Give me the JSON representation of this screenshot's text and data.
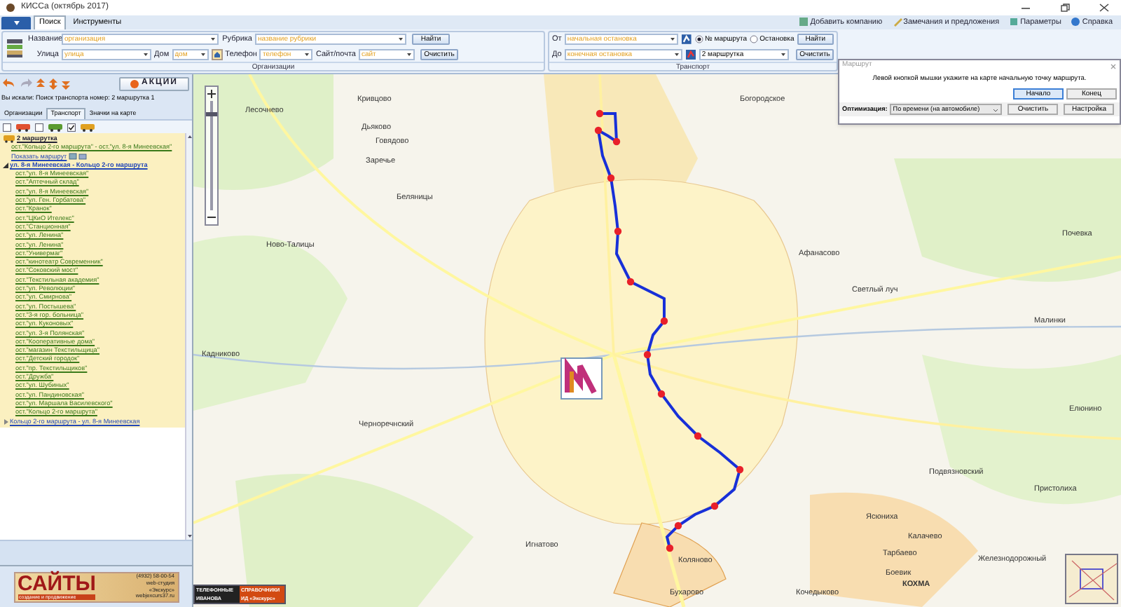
{
  "window": {
    "title": "КИССа (октябрь 2017)"
  },
  "ribbon": {
    "tabs": [
      {
        "label": "Поиск",
        "selected": true
      },
      {
        "label": "Инструменты",
        "selected": false
      }
    ],
    "links": [
      "Добавить компанию",
      "Замечания и предложения",
      "Параметры",
      "Справка"
    ],
    "organizations": {
      "label": "Организации",
      "fields": [
        {
          "label": "Название",
          "placeholder": "организация"
        },
        {
          "label": "Рубрика",
          "placeholder": "название рубрики"
        },
        {
          "label": "Улица",
          "placeholder": "улица"
        },
        {
          "label": "Дом",
          "placeholder": "дом"
        },
        {
          "label": "Телефон",
          "placeholder": "телефон"
        },
        {
          "label": "Сайт/почта",
          "placeholder": "сайт"
        }
      ],
      "buttons": [
        "Найти",
        "Очистить"
      ]
    },
    "transport": {
      "label": "Транспорт",
      "from": {
        "label": "От",
        "placeholder": "начальная остановка"
      },
      "to": {
        "label": "До",
        "placeholder": "конечная остановка"
      },
      "radios": [
        {
          "label": "№ маршрута",
          "selected": true
        },
        {
          "label": "Остановка",
          "selected": false
        }
      ],
      "route_value": "2 маршрутка",
      "buttons": [
        "Найти",
        "Очистить"
      ]
    }
  },
  "left_panel": {
    "promo_button": "АКЦИИ",
    "search_info": "Вы искали: Поиск транспорта номер: 2 маршрутка 1",
    "tabs": [
      {
        "label": "Организации",
        "selected": false
      },
      {
        "label": "Транспорт",
        "selected": true
      },
      {
        "label": "Значки на карте",
        "selected": false
      }
    ],
    "filters": [
      {
        "checked": false
      },
      {
        "checked": false
      },
      {
        "checked": true
      }
    ],
    "tree": {
      "title": "2 маршрутка",
      "summary": "ост.\"Кольцо 2-го маршрута\" - ост.\"ул. 8-я Минеевская\"",
      "show_link": "Показать маршрут",
      "directions": [
        {
          "label": "ул. 8-я Минеевская - Кольцо 2-го маршрута",
          "expanded": true,
          "children": [
            "ост.\"ул. 8-я Минеевская\"",
            "ост.\"Аптечный склад\"",
            "ост.\"ул. 8-я Минеевская\"",
            "ост.\"ул. Ген. Горбатова\"",
            "ост.\"Кранок\"",
            "ост.\"ЦКиО Ителекс\"",
            "ост.\"Станционная\"",
            "ост.\"ул. Ленина\"",
            "ост.\"ул. Ленина\"",
            "ост.\"Универмаг\"",
            "ост.\"кинотеатр Современник\"",
            "ост.\"Соковский мост\"",
            "ост.\"Текстильная академия\"",
            "ост.\"ул. Революции\"",
            "ост.\"ул. Смирнова\"",
            "ост.\"ул. Постышева\"",
            "ост.\"3-я гор. больница\"",
            "ост.\"ул. Куконовых\"",
            "ост.\"ул. 3-я Полянская\"",
            "ост.\"Кооперативные дома\"",
            "ост.\"магазин Текстильщица\"",
            "ост.\"Детский городок\"",
            "ост.\"пр. Текстильщиков\"",
            "ост.\"Дружба\"",
            "ост.\"ул. Шубиных\"",
            "ост.\"ул. Пандиновская\"",
            "ост.\"ул. Маршала Василевского\"",
            "ост.\"Кольцо 2-го маршрута\""
          ]
        },
        {
          "label": "Кольцо 2-го маршрута - ул. 8-я Минеевская",
          "expanded": false
        }
      ]
    },
    "ad": {
      "headline": "САЙТЫ",
      "tagline": "создание и продвижение",
      "lines": [
        "(4932) 58-00-54",
        "web-студия",
        "«Экскурс»",
        "webjexcurs37.ru"
      ]
    }
  },
  "map": {
    "zoom_slider": {
      "level": 0.9
    },
    "places": [
      "Лесочнево",
      "Кривцово",
      "Дьяково",
      "Говядово",
      "Заречье",
      "Беляницы",
      "Богородское",
      "Ново-Талицы",
      "Афанасово",
      "Почевка",
      "Светлый луч",
      "Малинки",
      "Кадниково",
      "Черноречнский",
      "Елюнино",
      "Подвязновский",
      "Пристолиха",
      "Ясюниха",
      "Калачево",
      "Тарбаево",
      "Игнатово",
      "Коляново",
      "Железнодорожный",
      "Боевик",
      "КОХМА",
      "Бухарово",
      "Кочедыково"
    ],
    "ad": {
      "lines": [
        "ТЕЛЕФОННЫЕ",
        "ИВАНОВА"
      ],
      "lines_2": [
        "СПРАВОЧНИКИ",
        "ИД «Экскурс»"
      ]
    }
  },
  "route_dialog": {
    "title": "Маршрут",
    "instruction": "Левой кнопкой мышки укажите на карте начальную точку маршрута.",
    "buttons_top": [
      {
        "label": "Начало",
        "selected": true
      },
      {
        "label": "Конец",
        "selected": false
      }
    ],
    "optimization_label": "Оптимизация:",
    "optimization_value": "По времени (на автомобиле)",
    "buttons_bottom": [
      "Очистить",
      "Настройка"
    ]
  }
}
